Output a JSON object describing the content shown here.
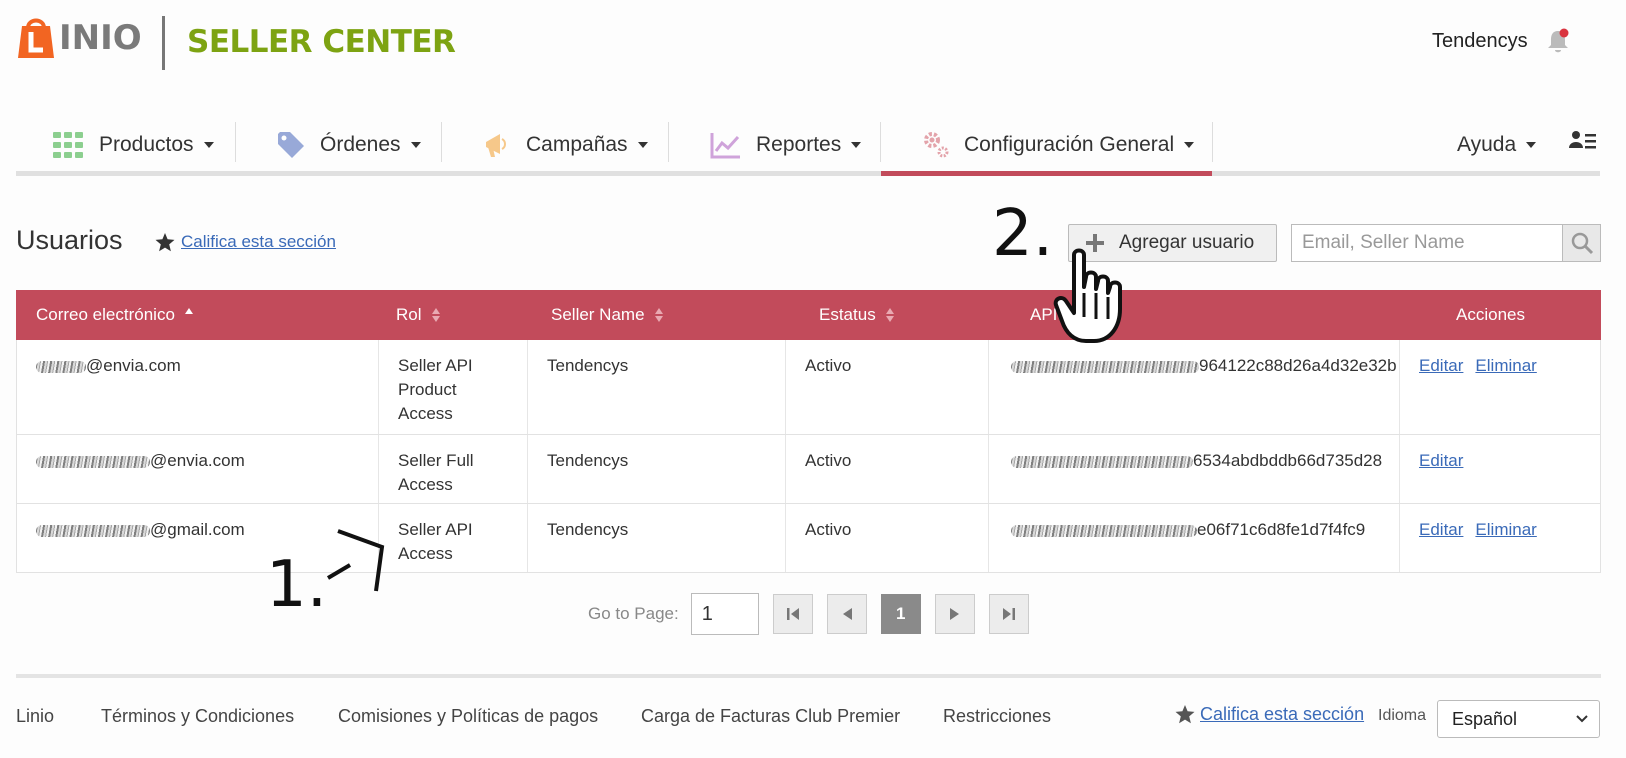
{
  "brand": {
    "logo_text": "INIO",
    "logo_letter": "L",
    "product": "SELLER CENTER"
  },
  "header": {
    "username": "Tendencys"
  },
  "nav": {
    "items": [
      {
        "label": "Productos",
        "icon": "grid-icon"
      },
      {
        "label": "Órdenes",
        "icon": "tag-icon"
      },
      {
        "label": "Campañas",
        "icon": "megaphone-icon"
      },
      {
        "label": "Reportes",
        "icon": "chart-icon"
      },
      {
        "label": "Configuración General",
        "icon": "gear-icon",
        "active": true
      }
    ],
    "help": "Ayuda"
  },
  "page": {
    "title": "Usuarios",
    "rate_label": "Califica esta sección",
    "add_user": "Agregar usuario",
    "search_placeholder": "Email, Seller Name"
  },
  "table": {
    "columns": [
      "Correo electrónico",
      "Rol",
      "Seller Name",
      "Estatus",
      "API",
      "Acciones"
    ],
    "rows": [
      {
        "email": "@envia.com",
        "role": "Seller API Product Access",
        "seller": "Tendencys",
        "status": "Activo",
        "api": "964122c88d26a4d32e32b",
        "actions": [
          "Editar",
          "Eliminar"
        ]
      },
      {
        "email": "@envia.com",
        "role": "Seller Full Access",
        "seller": "Tendencys",
        "status": "Activo",
        "api": "6534abdbddb66d735d28",
        "actions": [
          "Editar"
        ]
      },
      {
        "email": "@gmail.com",
        "role": "Seller API Access",
        "seller": "Tendencys",
        "status": "Activo",
        "api": "e06f71c6d8fe1d7f4fc9",
        "actions": [
          "Editar",
          "Eliminar"
        ]
      }
    ]
  },
  "pagination": {
    "label": "Go to Page:",
    "value": "1",
    "current": "1"
  },
  "annotations": {
    "one": "1.",
    "two": "2."
  },
  "footer": {
    "links": [
      "Linio",
      "Términos y Condiciones",
      "Comisiones y Políticas de pagos",
      "Carga de Facturas Club Premier",
      "Restricciones"
    ],
    "rate_label": "Califica esta sección",
    "language_label": "Idioma",
    "language_value": "Español"
  },
  "colors": {
    "accent": "#c24b5b",
    "brand_green": "#7da312",
    "brand_orange": "#f26522",
    "link": "#3a6ab8"
  }
}
